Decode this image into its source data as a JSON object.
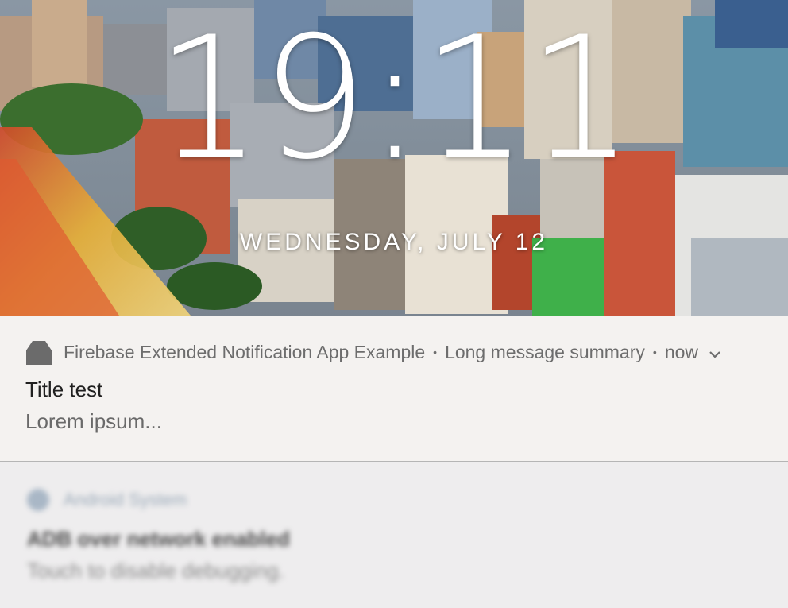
{
  "lockscreen": {
    "time": "19:11",
    "date": "WEDNESDAY, JULY 12"
  },
  "notification": {
    "app_name": "Firebase Extended Notification App Example",
    "summary": "Long message summary",
    "timestamp": "now",
    "separator": "•",
    "title": "Title test",
    "body": "Lorem ipsum...",
    "icon": "android-head-icon",
    "expand_icon": "chevron-down-icon"
  },
  "notification_2": {
    "app_name": "Android System",
    "title": "ADB over network enabled",
    "body": "Touch to disable debugging.",
    "icon": "android-system-icon"
  },
  "colors": {
    "card_bg": "#f8f6f5",
    "title_text": "#202020",
    "secondary_text": "#6d6d6d"
  }
}
